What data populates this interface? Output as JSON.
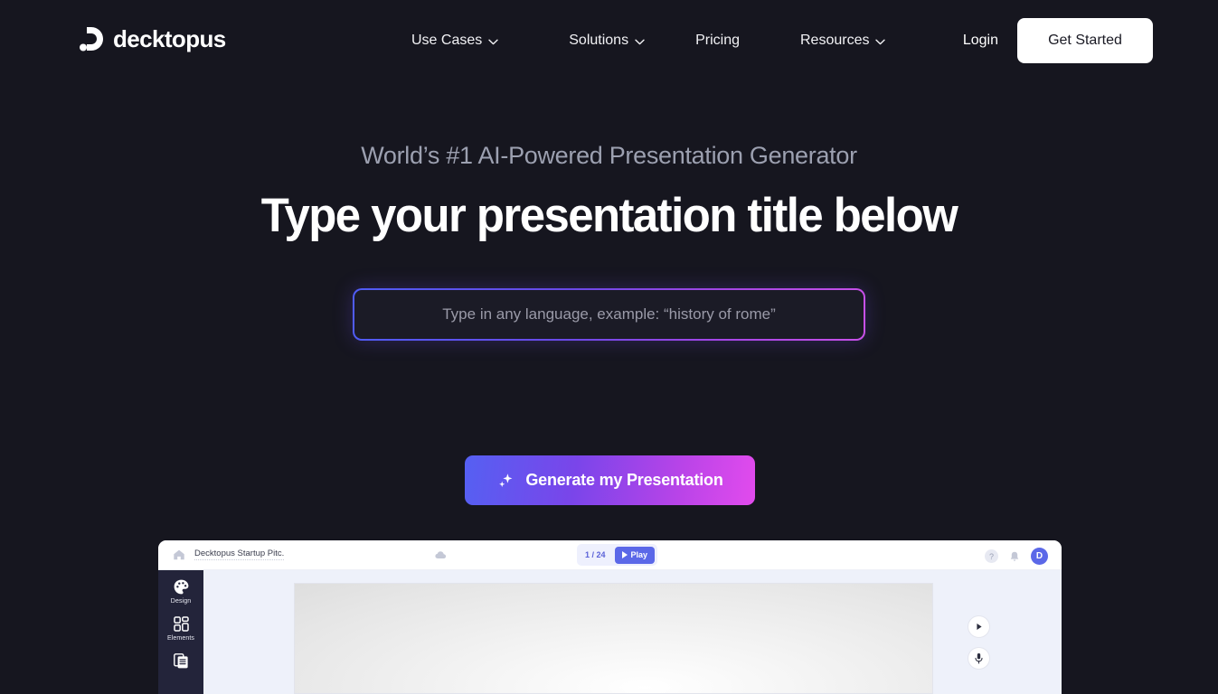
{
  "brand": {
    "name": "decktopus",
    "logo_icon": "decktopus-logo-icon"
  },
  "header": {
    "nav": [
      {
        "label": "Use Cases",
        "has_dropdown": true,
        "icon": "chevron-down-icon"
      },
      {
        "label": "Solutions",
        "has_dropdown": true,
        "icon": "chevron-down-icon"
      },
      {
        "label": "Pricing",
        "has_dropdown": false
      },
      {
        "label": "Resources",
        "has_dropdown": true,
        "icon": "chevron-down-icon"
      }
    ],
    "login_label": "Login",
    "get_started_label": "Get Started"
  },
  "hero": {
    "eyebrow": "World’s #1 AI-Powered Presentation Generator",
    "headline": "Type your presentation title below",
    "input": {
      "value": "",
      "placeholder": "Type in any language, example: “history of rome”"
    },
    "cta_label": "Generate my Presentation",
    "cta_icon": "sparkle-icon",
    "decor_icon": "four-point-star-icon"
  },
  "app_preview": {
    "topbar": {
      "home_icon": "home-icon",
      "doc_title": "Decktopus Startup Pitc.",
      "cloud_icon": "cloud-save-icon",
      "slide_counter": "1 / 24",
      "play_label": "Play",
      "play_icon": "play-icon",
      "help_label": "?",
      "help_icon": "help-circle-icon",
      "bell_icon": "bell-icon",
      "avatar_initial": "D"
    },
    "sidebar": [
      {
        "label": "Design",
        "icon": "palette-icon"
      },
      {
        "label": "Elements",
        "icon": "grid-elements-icon"
      },
      {
        "label": "",
        "icon": "pages-copy-icon"
      }
    ],
    "canvas": {
      "play_icon": "play-triangle-icon",
      "mic_icon": "microphone-icon"
    }
  },
  "colors": {
    "page_bg": "#16161f",
    "accent_blue": "#5560f2",
    "accent_magenta": "#e24bed",
    "app_accent": "#5b68e8",
    "eyebrow_text": "#9ca0b0"
  }
}
